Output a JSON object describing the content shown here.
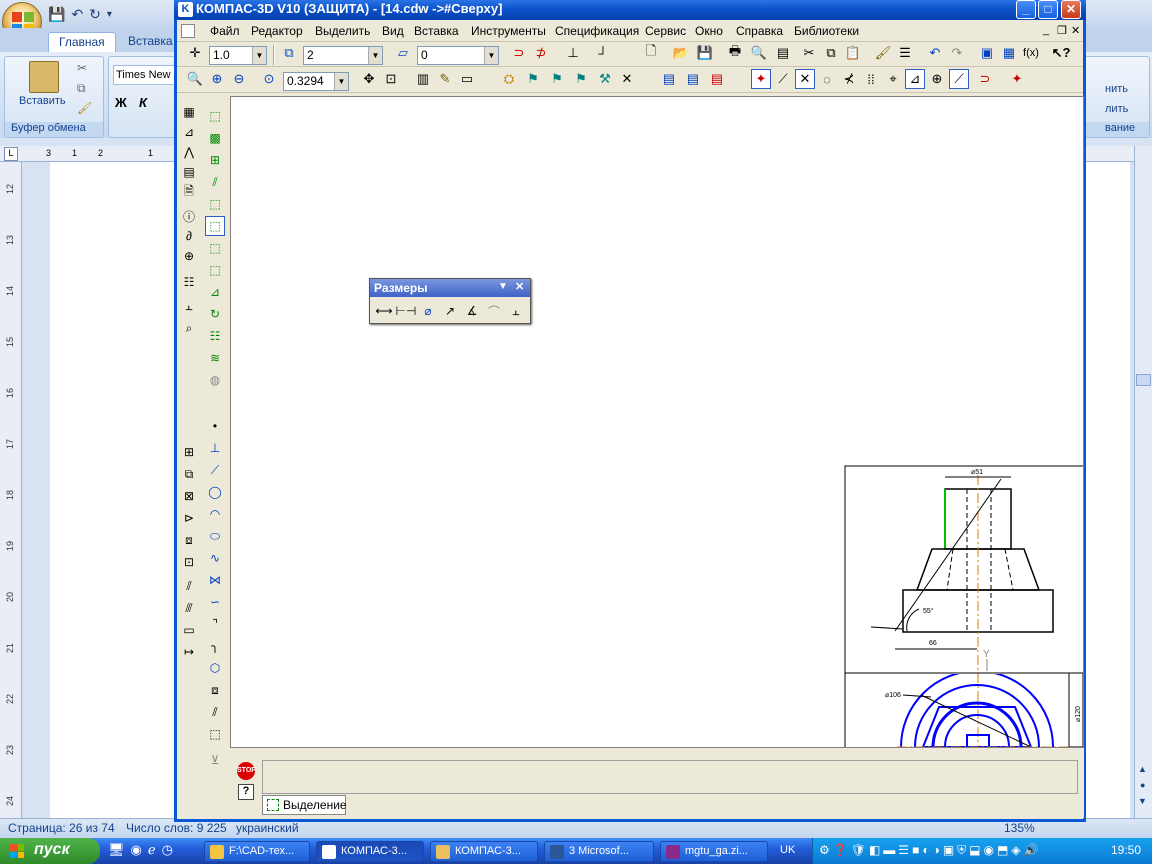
{
  "word": {
    "tabs": [
      "Главная",
      "Вставка"
    ],
    "group_paste_label": "Вставить",
    "group_clipboard": "Буфер обмена",
    "font_name": "Times New",
    "bold": "Ж",
    "italic": "К",
    "right_frag1": "нить",
    "right_frag2": "лить",
    "right_frag3": "вание",
    "ruler_h_marks": [
      "3",
      "1",
      "2",
      "1"
    ],
    "ruler_v_marks": [
      "12",
      "13",
      "14",
      "15",
      "16",
      "17",
      "18",
      "19",
      "20",
      "21",
      "22",
      "23",
      "24"
    ],
    "status_page": "Страница: 26 из 74",
    "status_words": "Число слов: 9 225",
    "status_lang": "украинский",
    "zoom": "135%"
  },
  "kompas": {
    "title": "КОМПАС-3D V10 (ЗАЩИТА) - [14.cdw ->#Сверху]",
    "menu": [
      "Файл",
      "Редактор",
      "Выделить",
      "Вид",
      "Вставка",
      "Инструменты",
      "Спецификация",
      "Сервис",
      "Окно",
      "Справка",
      "Библиотеки"
    ],
    "step_value": "1.0",
    "layer_value": "2",
    "style_value": "0",
    "zoom_value": "0.3294",
    "panel_title": "Размеры",
    "status_tab": "Выделение",
    "drawing": {
      "dim_top": "⌀51",
      "dim_bottom": "66",
      "dim_angle": "55°",
      "dim_circle": "⌀106",
      "dim_right": "⌀120",
      "axis_label": "Y"
    }
  },
  "taskbar": {
    "start": "пуск",
    "tasks": [
      "F:\\CAD-тех...",
      "КОМПАС-3...",
      "КОМПАС-3...",
      "3 Microsof...",
      "mgtu_ga.zi..."
    ],
    "lang": "UK",
    "clock": "19:50"
  },
  "colors": {
    "xp_blue": "#245edb",
    "kompas_title": "#0a4fc7",
    "drawing_blue": "#0000ff",
    "axis_orange": "#e07b00",
    "highlight_green": "#00c000"
  }
}
